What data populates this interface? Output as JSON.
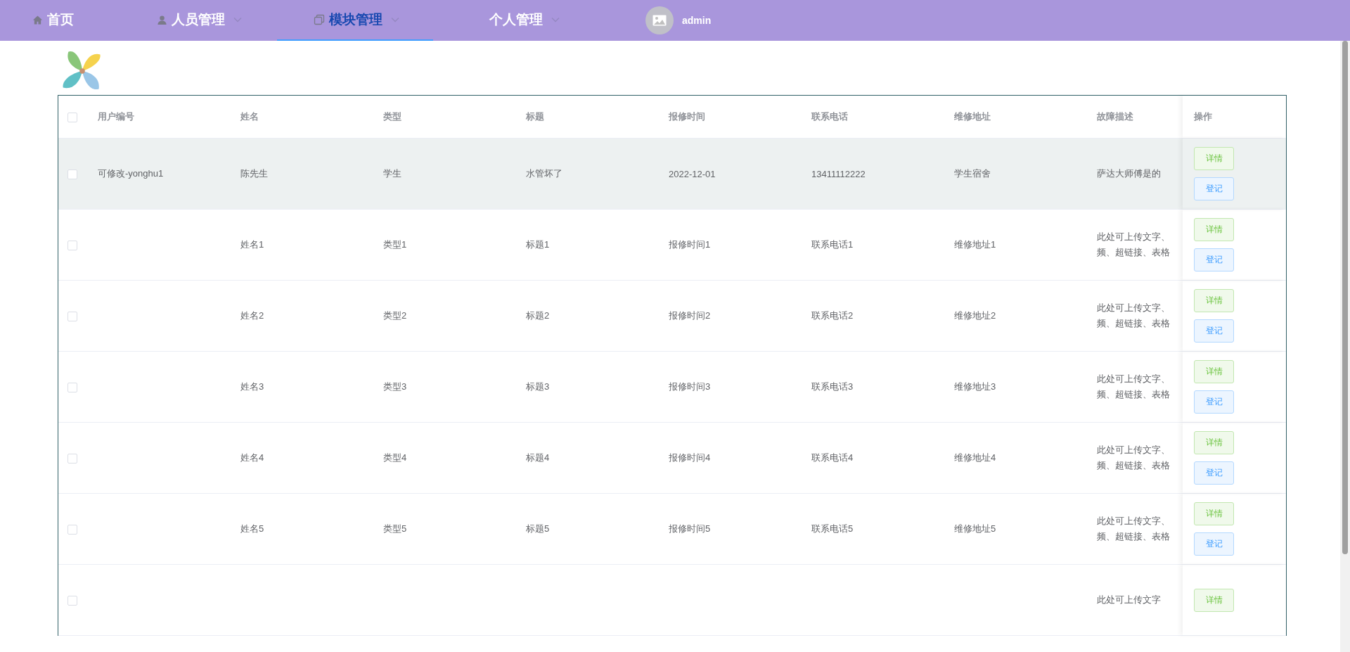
{
  "nav": {
    "items": [
      {
        "label": "首页",
        "kind": "home",
        "dropdown": false,
        "selected": false
      },
      {
        "label": "人员管理",
        "kind": "user",
        "dropdown": true,
        "selected": false
      },
      {
        "label": "模块管理",
        "kind": "copy",
        "dropdown": true,
        "selected": true
      },
      {
        "label": "个人管理",
        "kind": "plain",
        "dropdown": true,
        "selected": false
      }
    ],
    "user": {
      "name": "admin"
    }
  },
  "table": {
    "header_checked": false,
    "columns": [
      "用户编号",
      "姓名",
      "类型",
      "标题",
      "报修时间",
      "联系电话",
      "维修地址",
      "故障描述",
      "操作"
    ],
    "rows": [
      {
        "checked": false,
        "highlighted": true,
        "cells": [
          "可修改-yonghu1",
          "陈先生",
          "学生",
          "水管坏了",
          "2022-12-01",
          "13411112222",
          "学生宿舍"
        ],
        "description": [
          "萨达大师傅是的"
        ],
        "actions": [
          "详情",
          "登记"
        ]
      },
      {
        "checked": false,
        "highlighted": false,
        "cells": [
          "",
          "姓名1",
          "类型1",
          "标题1",
          "报修时间1",
          "联系电话1",
          "维修地址1"
        ],
        "description": [
          "此处可上传文字、",
          "频、超链接、表格"
        ],
        "actions": [
          "详情",
          "登记"
        ]
      },
      {
        "checked": false,
        "highlighted": false,
        "cells": [
          "",
          "姓名2",
          "类型2",
          "标题2",
          "报修时间2",
          "联系电话2",
          "维修地址2"
        ],
        "description": [
          "此处可上传文字、",
          "频、超链接、表格"
        ],
        "actions": [
          "详情",
          "登记"
        ]
      },
      {
        "checked": false,
        "highlighted": false,
        "cells": [
          "",
          "姓名3",
          "类型3",
          "标题3",
          "报修时间3",
          "联系电话3",
          "维修地址3"
        ],
        "description": [
          "此处可上传文字、",
          "频、超链接、表格"
        ],
        "actions": [
          "详情",
          "登记"
        ]
      },
      {
        "checked": false,
        "highlighted": false,
        "cells": [
          "",
          "姓名4",
          "类型4",
          "标题4",
          "报修时间4",
          "联系电话4",
          "维修地址4"
        ],
        "description": [
          "此处可上传文字、",
          "频、超链接、表格"
        ],
        "actions": [
          "详情",
          "登记"
        ]
      },
      {
        "checked": false,
        "highlighted": false,
        "cells": [
          "",
          "姓名5",
          "类型5",
          "标题5",
          "报修时间5",
          "联系电话5",
          "维修地址5"
        ],
        "description": [
          "此处可上传文字、",
          "频、超链接、表格"
        ],
        "actions": [
          "详情",
          "登记"
        ]
      },
      {
        "checked": false,
        "highlighted": false,
        "cells": [
          "",
          "",
          "",
          "",
          "",
          "",
          ""
        ],
        "description": [
          "此处可上传文字"
        ],
        "actions": [
          "详情"
        ]
      }
    ]
  }
}
